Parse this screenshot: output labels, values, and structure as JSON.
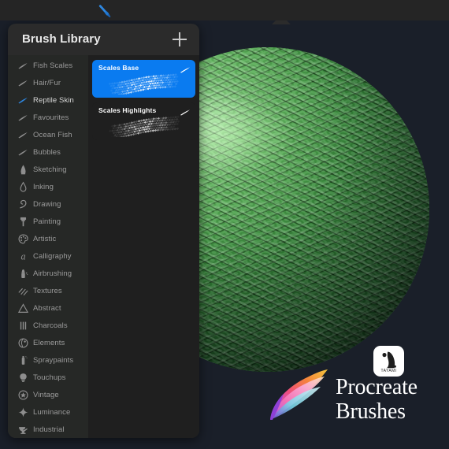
{
  "app": {
    "background_color": "#1a1f29",
    "toolbar_color": "#252525",
    "accent_color": "#0a7bf0"
  },
  "toolbar": {
    "brush_tool_icon": "paintbrush-icon"
  },
  "artwork": {
    "name": "green-reptile-scales-sphere",
    "base_color": "#2c7231",
    "highlight_color": "#6ec46a",
    "shadow_color": "#0a240f"
  },
  "brush_library": {
    "title": "Brush Library",
    "add_button_label": "+",
    "sets": [
      {
        "label": "Fish Scales",
        "icon": "brush-stroke-icon",
        "selected": false
      },
      {
        "label": "Hair/Fur",
        "icon": "brush-stroke-icon",
        "selected": false
      },
      {
        "label": "Reptile Skin",
        "icon": "brush-stroke-icon",
        "selected": true
      },
      {
        "label": "Favourites",
        "icon": "brush-stroke-icon",
        "selected": false
      },
      {
        "label": "Ocean Fish",
        "icon": "brush-stroke-icon",
        "selected": false
      },
      {
        "label": "Bubbles",
        "icon": "brush-stroke-icon",
        "selected": false
      },
      {
        "label": "Sketching",
        "icon": "pencil-tip-icon",
        "selected": false
      },
      {
        "label": "Inking",
        "icon": "ink-drop-icon",
        "selected": false
      },
      {
        "label": "Drawing",
        "icon": "squiggle-icon",
        "selected": false
      },
      {
        "label": "Painting",
        "icon": "paint-brush-icon",
        "selected": false
      },
      {
        "label": "Artistic",
        "icon": "palette-icon",
        "selected": false
      },
      {
        "label": "Calligraphy",
        "icon": "letter-a-icon",
        "selected": false
      },
      {
        "label": "Airbrushing",
        "icon": "airbrush-icon",
        "selected": false
      },
      {
        "label": "Textures",
        "icon": "hatching-icon",
        "selected": false
      },
      {
        "label": "Abstract",
        "icon": "triangle-icon",
        "selected": false
      },
      {
        "label": "Charcoals",
        "icon": "three-bars-icon",
        "selected": false
      },
      {
        "label": "Elements",
        "icon": "globe-icon",
        "selected": false
      },
      {
        "label": "Spraypaints",
        "icon": "spray-can-icon",
        "selected": false
      },
      {
        "label": "Touchups",
        "icon": "bulb-icon",
        "selected": false
      },
      {
        "label": "Vintage",
        "icon": "star-circle-icon",
        "selected": false
      },
      {
        "label": "Luminance",
        "icon": "sparkle-icon",
        "selected": false
      },
      {
        "label": "Industrial",
        "icon": "anvil-icon",
        "selected": false
      }
    ],
    "brushes": [
      {
        "name": "Scales Base",
        "selected": true,
        "edit_icon": "brush-edit-icon"
      },
      {
        "name": "Scales Highlights",
        "selected": false,
        "edit_icon": "brush-edit-icon"
      }
    ]
  },
  "branding": {
    "badge_text": "TAYAMI",
    "badge_icon": "cat-silhouette-icon",
    "swirl_icon": "procreate-swirl-icon",
    "line1": "Procreate",
    "line2": "Brushes"
  }
}
